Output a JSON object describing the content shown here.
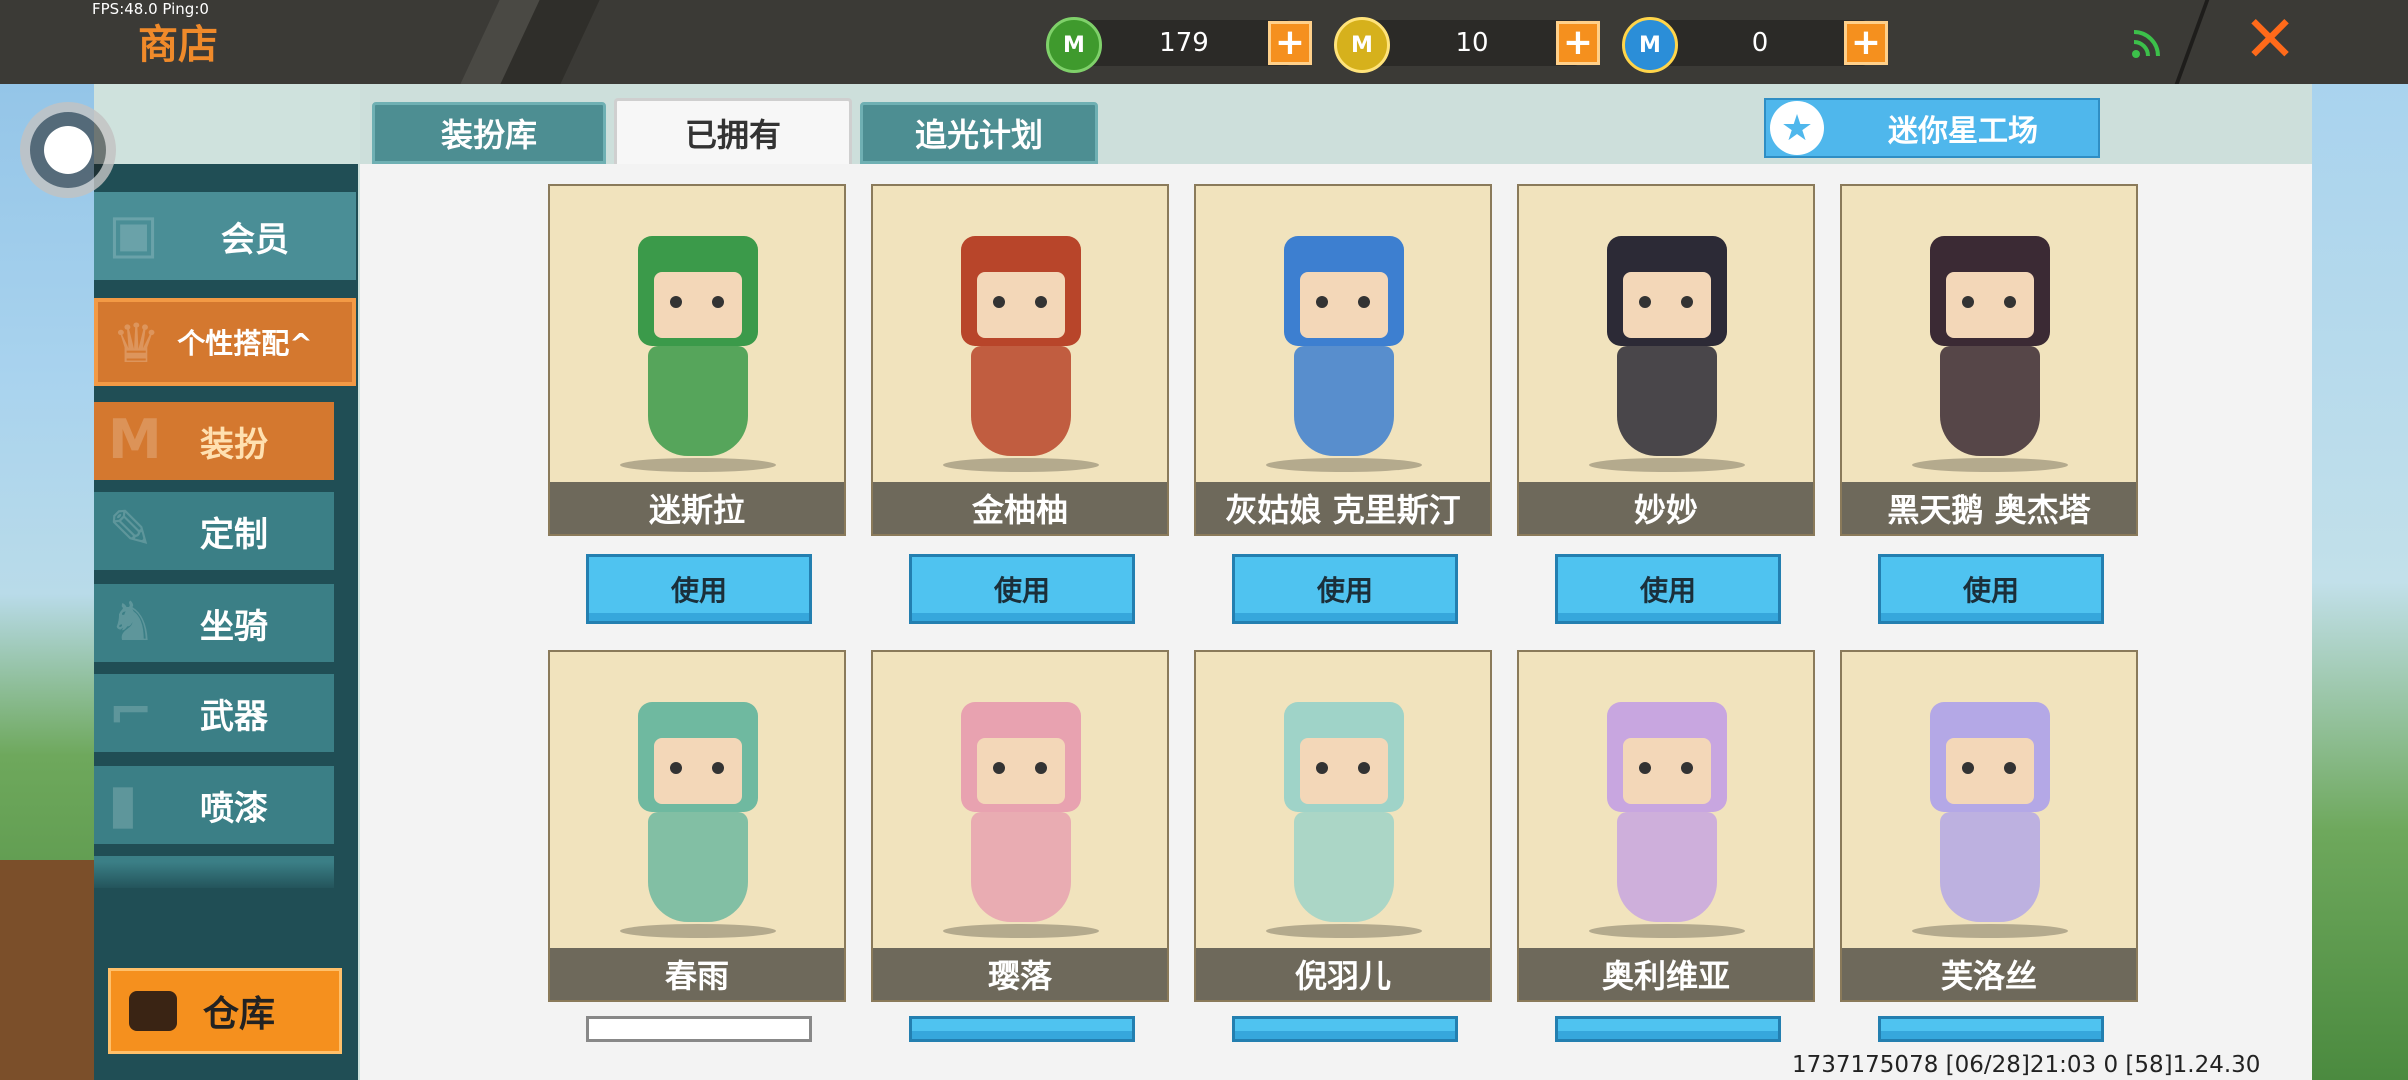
{
  "debug": {
    "fps": "FPS:48.0  Ping:0"
  },
  "header": {
    "title": "商店",
    "currencies": [
      {
        "name": "green-mini-coin-icon",
        "glyph": "M",
        "color": "#3f9a2d",
        "value": "179"
      },
      {
        "name": "gold-mini-coin-icon",
        "glyph": "M",
        "color": "#d6b11c",
        "value": "10"
      },
      {
        "name": "blue-mini-coin-icon",
        "glyph": "M",
        "color": "#2b8ed8",
        "value": "0"
      }
    ],
    "plus": "+",
    "close": "✕"
  },
  "tabs": [
    {
      "label": "装扮库",
      "active": false
    },
    {
      "label": "已拥有",
      "active": true
    },
    {
      "label": "追光计划",
      "active": false
    }
  ],
  "workshop": {
    "label": "迷你星工场",
    "icon": "★"
  },
  "sidebar": {
    "member": "会员",
    "styling": "个性搭配^",
    "subs": [
      "装扮",
      "定制",
      "坐骑",
      "武器",
      "喷漆"
    ],
    "warehouse": "仓库"
  },
  "cards": {
    "row1": [
      {
        "name": "迷斯拉",
        "action": "使用",
        "color": "#3b9a4a"
      },
      {
        "name": "金柚柚",
        "action": "使用",
        "color": "#b8452a"
      },
      {
        "name": "灰姑娘 克里斯汀",
        "action": "使用",
        "color": "#3d7fd0"
      },
      {
        "name": "妙妙",
        "action": "使用",
        "color": "#2c2a36"
      },
      {
        "name": "黑天鹅 奥杰塔",
        "action": "使用",
        "color": "#3b2a34"
      }
    ],
    "row2": [
      {
        "name": "春雨",
        "color": "#6fb9a0"
      },
      {
        "name": "璎落",
        "color": "#e8a2b0"
      },
      {
        "name": "倪羽儿",
        "color": "#9fd3c8"
      },
      {
        "name": "奥利维亚",
        "color": "#c8a6e0"
      },
      {
        "name": "芙洛丝",
        "color": "#b4a8e6"
      }
    ]
  },
  "footer": {
    "info": "1737175078   [06/28]21:03 0  [58]1.24.30"
  }
}
